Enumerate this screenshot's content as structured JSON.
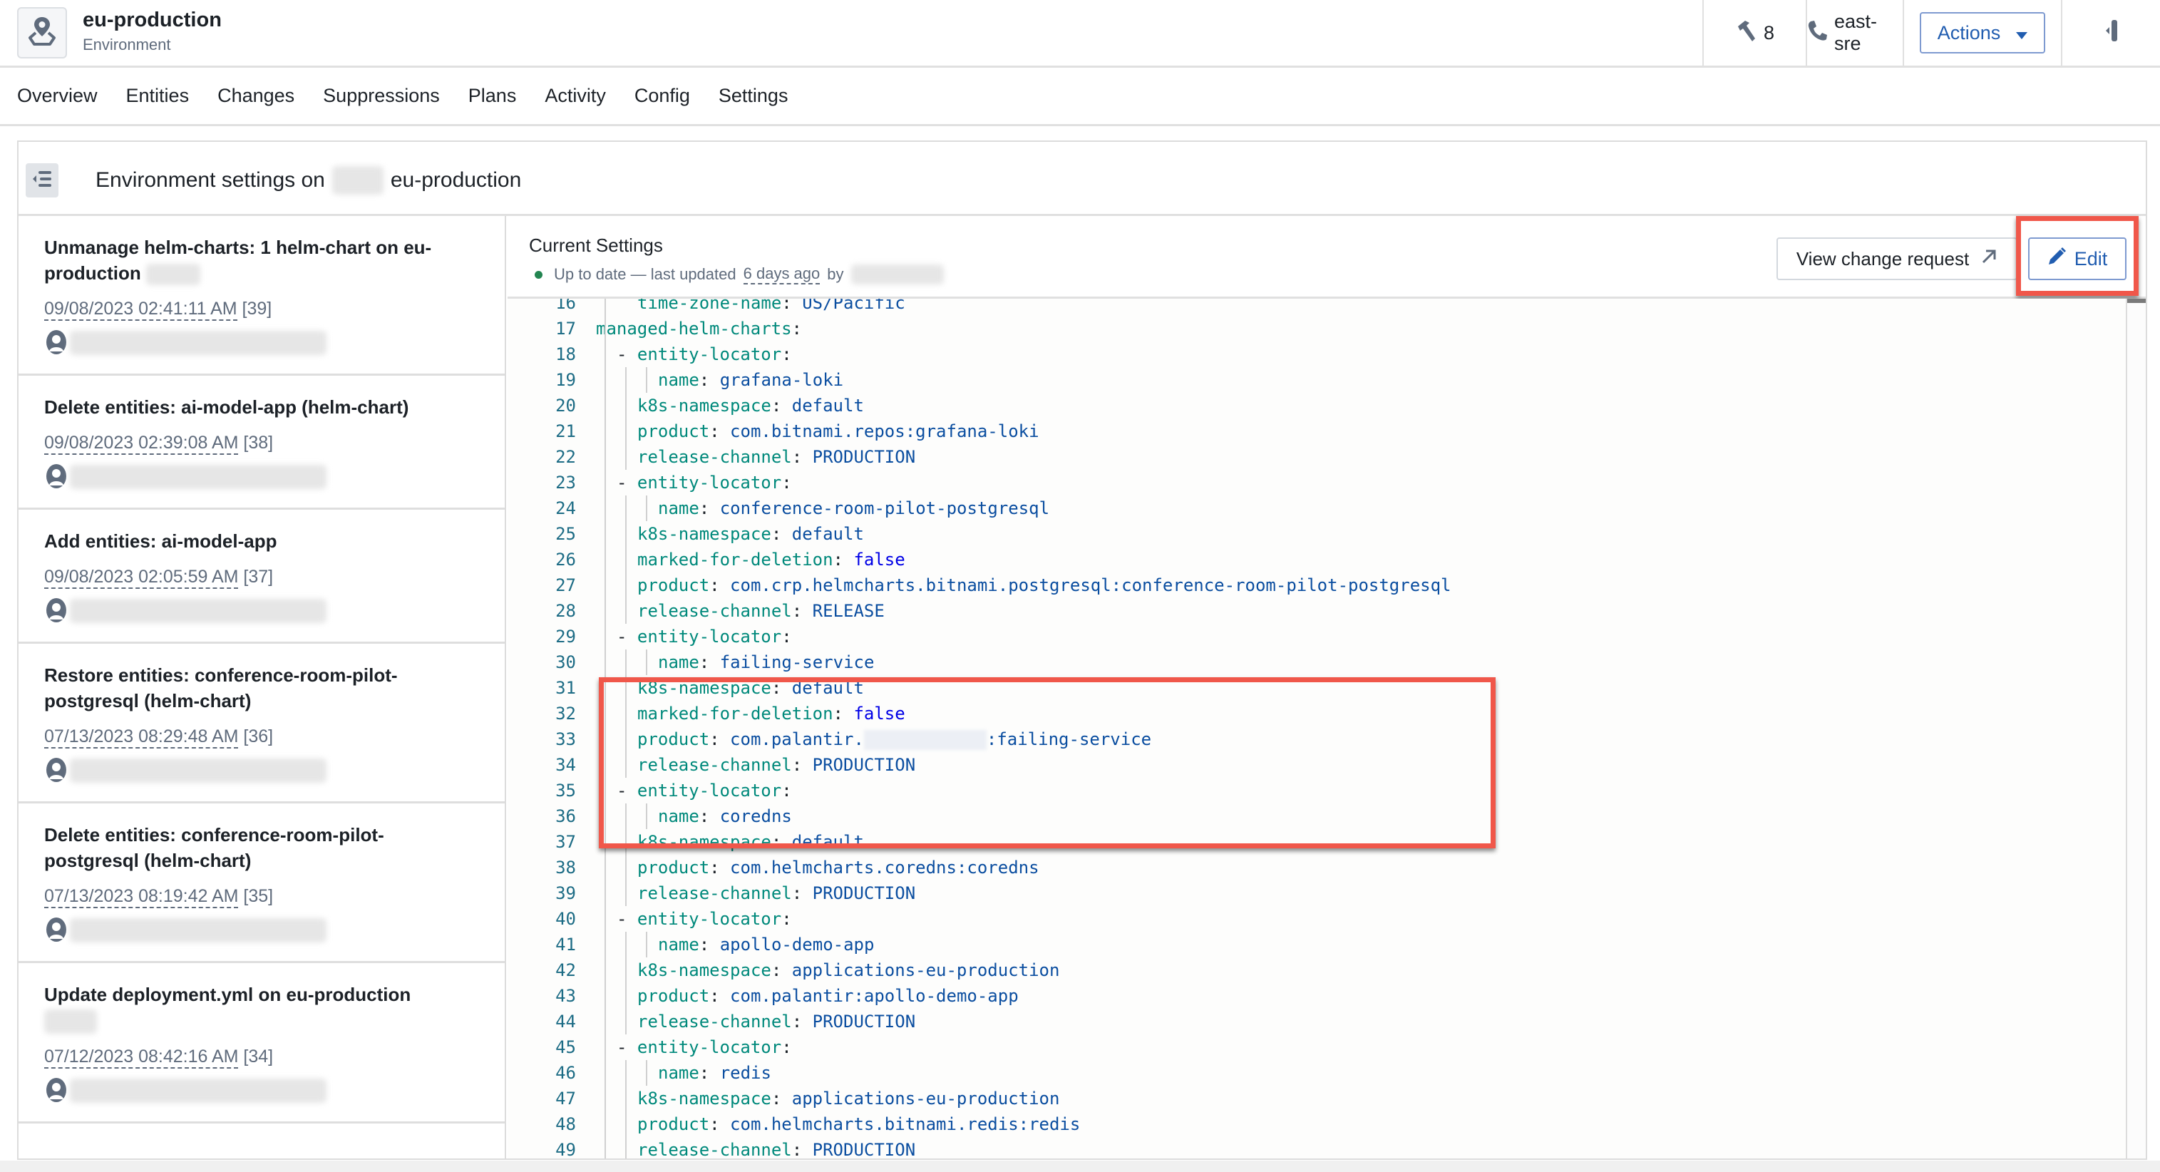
{
  "header": {
    "title": "eu-production",
    "subtitle": "Environment",
    "icon": "environment-pin-icon",
    "hammer_count": "8",
    "oncall_team": "east-sre",
    "actions_label": "Actions"
  },
  "tabs": [
    {
      "label": "Overview"
    },
    {
      "label": "Entities"
    },
    {
      "label": "Changes"
    },
    {
      "label": "Suppressions"
    },
    {
      "label": "Plans"
    },
    {
      "label": "Activity"
    },
    {
      "label": "Config"
    },
    {
      "label": "Settings"
    }
  ],
  "card": {
    "title_prefix": "Environment settings on",
    "title_suffix": "eu-production"
  },
  "history": [
    {
      "title": "Unmanage helm-charts: 1 helm-chart on eu-production",
      "has_redacted_suffix": true,
      "timestamp": "09/08/2023 02:41:11 AM",
      "revision": "[39]"
    },
    {
      "title": "Delete entities: ai-model-app (helm-chart)",
      "has_redacted_suffix": false,
      "timestamp": "09/08/2023 02:39:08 AM",
      "revision": "[38]"
    },
    {
      "title": "Add entities: ai-model-app",
      "has_redacted_suffix": false,
      "timestamp": "09/08/2023 02:05:59 AM",
      "revision": "[37]"
    },
    {
      "title": "Restore entities: conference-room-pilot-postgresql (helm-chart)",
      "has_redacted_suffix": false,
      "timestamp": "07/13/2023 08:29:48 AM",
      "revision": "[36]"
    },
    {
      "title": "Delete entities: conference-room-pilot-postgresql (helm-chart)",
      "has_redacted_suffix": false,
      "timestamp": "07/13/2023 08:19:42 AM",
      "revision": "[35]"
    },
    {
      "title": "Update deployment.yml on eu-production",
      "has_redacted_suffix": true,
      "timestamp": "07/12/2023 08:42:16 AM",
      "revision": "[34]"
    }
  ],
  "settings": {
    "title": "Current Settings",
    "status_text": "Up to date — last updated",
    "status_relative_time": "6 days ago",
    "status_by": "by",
    "status_color": "#238551",
    "view_change_request_label": "View change request",
    "edit_label": "Edit"
  },
  "code_lines": [
    {
      "n": "16",
      "indent": 2,
      "key": "time-zone-name",
      "value": "US/Pacific",
      "vtype": "v"
    },
    {
      "n": "17",
      "indent": 0,
      "key": "managed-helm-charts",
      "value": "",
      "vtype": "v"
    },
    {
      "n": "18",
      "indent": 1,
      "dash": true,
      "key": "entity-locator",
      "value": "",
      "vtype": "v"
    },
    {
      "n": "19",
      "indent": 3,
      "key": "name",
      "value": "grafana-loki",
      "vtype": "v"
    },
    {
      "n": "20",
      "indent": 2,
      "key": "k8s-namespace",
      "value": "default",
      "vtype": "v"
    },
    {
      "n": "21",
      "indent": 2,
      "key": "product",
      "value": "com.bitnami.repos:grafana-loki",
      "vtype": "v"
    },
    {
      "n": "22",
      "indent": 2,
      "key": "release-channel",
      "value": "PRODUCTION",
      "vtype": "v"
    },
    {
      "n": "23",
      "indent": 1,
      "dash": true,
      "key": "entity-locator",
      "value": "",
      "vtype": "v"
    },
    {
      "n": "24",
      "indent": 3,
      "key": "name",
      "value": "conference-room-pilot-postgresql",
      "vtype": "v"
    },
    {
      "n": "25",
      "indent": 2,
      "key": "k8s-namespace",
      "value": "default",
      "vtype": "v"
    },
    {
      "n": "26",
      "indent": 2,
      "key": "marked-for-deletion",
      "value": "false",
      "vtype": "b"
    },
    {
      "n": "27",
      "indent": 2,
      "key": "product",
      "value": "com.crp.helmcharts.bitnami.postgresql:conference-room-pilot-postgresql",
      "vtype": "v"
    },
    {
      "n": "28",
      "indent": 2,
      "key": "release-channel",
      "value": "RELEASE",
      "vtype": "v"
    },
    {
      "n": "29",
      "indent": 1,
      "dash": true,
      "key": "entity-locator",
      "value": "",
      "vtype": "v"
    },
    {
      "n": "30",
      "indent": 3,
      "key": "name",
      "value": "failing-service",
      "vtype": "v"
    },
    {
      "n": "31",
      "indent": 2,
      "key": "k8s-namespace",
      "value": "default",
      "vtype": "v"
    },
    {
      "n": "32",
      "indent": 2,
      "key": "marked-for-deletion",
      "value": "false",
      "vtype": "b"
    },
    {
      "n": "33",
      "indent": 2,
      "key": "product",
      "value": "com.palantir.",
      "value_suffix": ":failing-service",
      "redacted": true,
      "vtype": "v"
    },
    {
      "n": "34",
      "indent": 2,
      "key": "release-channel",
      "value": "PRODUCTION",
      "vtype": "v"
    },
    {
      "n": "35",
      "indent": 1,
      "dash": true,
      "key": "entity-locator",
      "value": "",
      "vtype": "v"
    },
    {
      "n": "36",
      "indent": 3,
      "key": "name",
      "value": "coredns",
      "vtype": "v"
    },
    {
      "n": "37",
      "indent": 2,
      "key": "k8s-namespace",
      "value": "default",
      "vtype": "v"
    },
    {
      "n": "38",
      "indent": 2,
      "key": "product",
      "value": "com.helmcharts.coredns:coredns",
      "vtype": "v"
    },
    {
      "n": "39",
      "indent": 2,
      "key": "release-channel",
      "value": "PRODUCTION",
      "vtype": "v"
    },
    {
      "n": "40",
      "indent": 1,
      "dash": true,
      "key": "entity-locator",
      "value": "",
      "vtype": "v"
    },
    {
      "n": "41",
      "indent": 3,
      "key": "name",
      "value": "apollo-demo-app",
      "vtype": "v"
    },
    {
      "n": "42",
      "indent": 2,
      "key": "k8s-namespace",
      "value": "applications-eu-production",
      "vtype": "v"
    },
    {
      "n": "43",
      "indent": 2,
      "key": "product",
      "value": "com.palantir:apollo-demo-app",
      "vtype": "v"
    },
    {
      "n": "44",
      "indent": 2,
      "key": "release-channel",
      "value": "PRODUCTION",
      "vtype": "v"
    },
    {
      "n": "45",
      "indent": 1,
      "dash": true,
      "key": "entity-locator",
      "value": "",
      "vtype": "v"
    },
    {
      "n": "46",
      "indent": 3,
      "key": "name",
      "value": "redis",
      "vtype": "v"
    },
    {
      "n": "47",
      "indent": 2,
      "key": "k8s-namespace",
      "value": "applications-eu-production",
      "vtype": "v"
    },
    {
      "n": "48",
      "indent": 2,
      "key": "product",
      "value": "com.helmcharts.bitnami.redis:redis",
      "vtype": "v"
    },
    {
      "n": "49",
      "indent": 2,
      "key": "release-channel",
      "value": "PRODUCTION",
      "vtype": "v"
    }
  ],
  "annotations": {
    "highlight_color": "#f0574a",
    "highlighted_lines": [
      "23",
      "28"
    ],
    "highlighted_button": "edit"
  }
}
